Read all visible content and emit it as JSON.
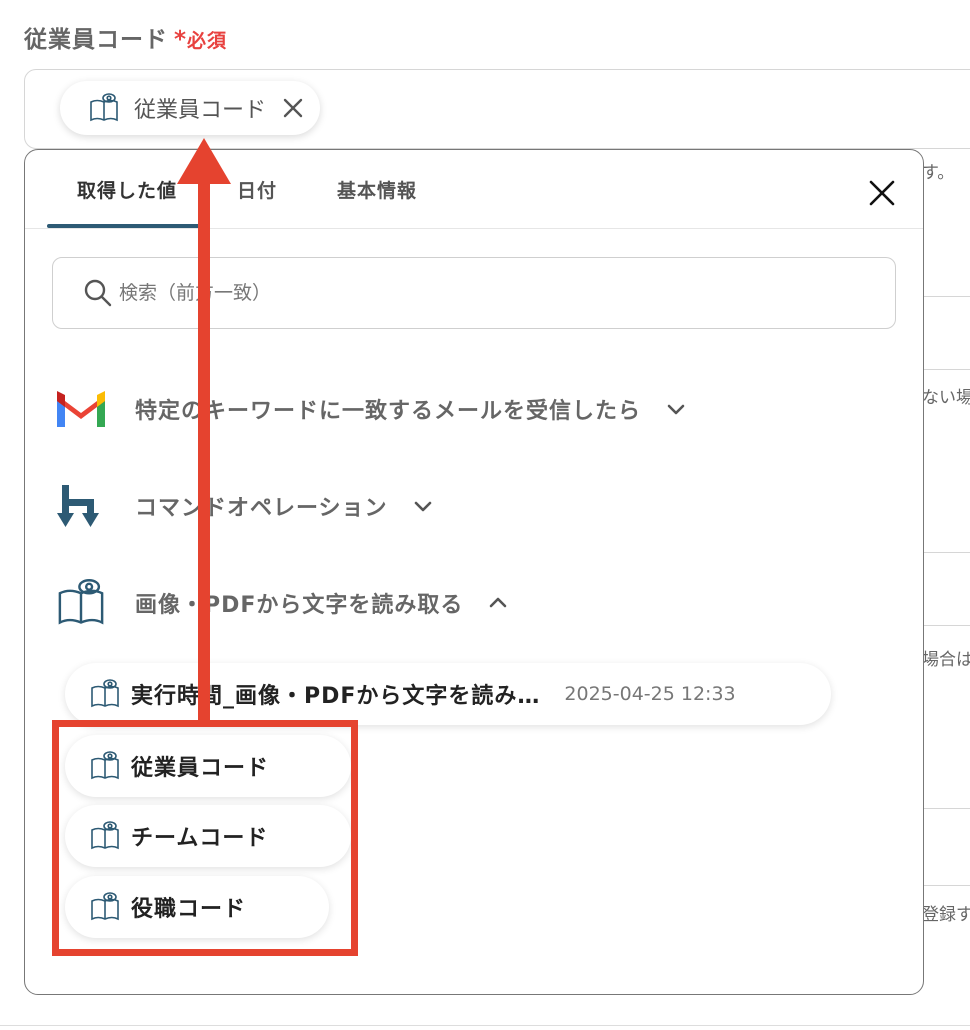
{
  "field": {
    "label": "従業員コード",
    "required_mark": "*",
    "required_text": "必須",
    "selected_chip": "従業員コード"
  },
  "background": {
    "fragment_1": "す。",
    "fragment_2": "ない場",
    "fragment_3": "場合は",
    "fragment_4": "登録す"
  },
  "panel": {
    "tabs": [
      {
        "label": "取得した値",
        "active": true
      },
      {
        "label": "日付",
        "active": false
      },
      {
        "label": "基本情報",
        "active": false
      }
    ],
    "search": {
      "placeholder": "検索（前方一致）"
    },
    "sections": [
      {
        "label": "特定のキーワードに一致するメールを受信したら",
        "icon": "gmail-icon",
        "expanded": false
      },
      {
        "label": "コマンドオペレーション",
        "icon": "command-operation-icon",
        "expanded": false
      },
      {
        "label": "画像・PDFから文字を読み取る",
        "icon": "ocr-book-icon",
        "expanded": true
      }
    ],
    "items": [
      {
        "label": "実行時間_画像・PDFから文字を読み…",
        "time": "2025-04-25 12:33"
      },
      {
        "label": "従業員コード"
      },
      {
        "label": "チームコード"
      },
      {
        "label": "役職コード"
      }
    ]
  },
  "colors": {
    "accent": "#2d5a74",
    "required": "#e8413f",
    "annotation": "#e5432f"
  }
}
